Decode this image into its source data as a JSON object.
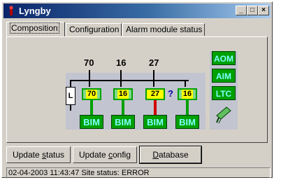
{
  "window": {
    "title": "Lyngby"
  },
  "tabs": [
    {
      "label": "Composition",
      "active": true
    },
    {
      "label": "Configuration",
      "active": false
    },
    {
      "label": "Alarm module status",
      "active": false
    }
  ],
  "diagram": {
    "top_values": [
      "70",
      "16",
      "27"
    ],
    "left_module": "L",
    "modules": [
      {
        "value": "70",
        "state": "ok"
      },
      {
        "value": "16",
        "state": "ok"
      },
      {
        "value": "27",
        "state": "alarm"
      },
      {
        "value": "16",
        "state": "ok"
      }
    ],
    "unknown_marker": "?",
    "bim_label": "BIM",
    "side_modules": [
      "AOM",
      "AIM",
      "LTC"
    ],
    "colors": {
      "ok": "#00a000",
      "alarm": "#ffff00",
      "alarm_link": "#d00000"
    }
  },
  "buttons": {
    "update_status": {
      "pre": "Update ",
      "mn": "s",
      "post": "tatus"
    },
    "update_config": {
      "pre": "Update ",
      "mn": "c",
      "post": "onfig"
    },
    "database": {
      "pre": "",
      "mn": "D",
      "post": "atabase"
    }
  },
  "status_bar": {
    "text": "02-04-2003 11:43:47 Site status: ERROR"
  }
}
